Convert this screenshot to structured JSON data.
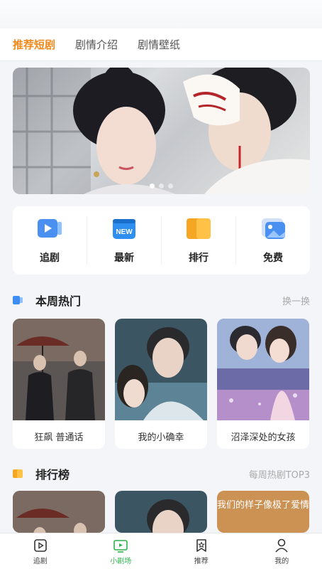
{
  "tabs": [
    {
      "label": "推荐短剧",
      "active": true
    },
    {
      "label": "剧情介绍",
      "active": false
    },
    {
      "label": "剧情壁纸",
      "active": false
    }
  ],
  "banner": {
    "dot_count": 3,
    "active_dot": 0
  },
  "quick_actions": [
    {
      "label": "追剧",
      "icon": "play-video-icon"
    },
    {
      "label": "最新",
      "icon": "new-calendar-icon"
    },
    {
      "label": "排行",
      "icon": "ranking-icon"
    },
    {
      "label": "免费",
      "icon": "free-image-icon"
    }
  ],
  "weekly_hot": {
    "title": "本周热门",
    "more_label": "换一换",
    "items": [
      {
        "title": "狂飙 普通话"
      },
      {
        "title": "我的小确幸"
      },
      {
        "title": "沼泽深处的女孩"
      }
    ]
  },
  "ranking": {
    "title": "排行榜",
    "more_label": "每周热剧TOP3",
    "poster_text": "我们的样子像极了爱情"
  },
  "bottom_nav": [
    {
      "label": "追剧",
      "active": false
    },
    {
      "label": "小剧场",
      "active": true
    },
    {
      "label": "推荐",
      "active": false
    },
    {
      "label": "我的",
      "active": false
    }
  ],
  "colors": {
    "accent_orange": "#f08a1d",
    "nav_active_green": "#2bb24c",
    "section_blue": "#3d8ef0",
    "section_orange": "#f5a623"
  }
}
